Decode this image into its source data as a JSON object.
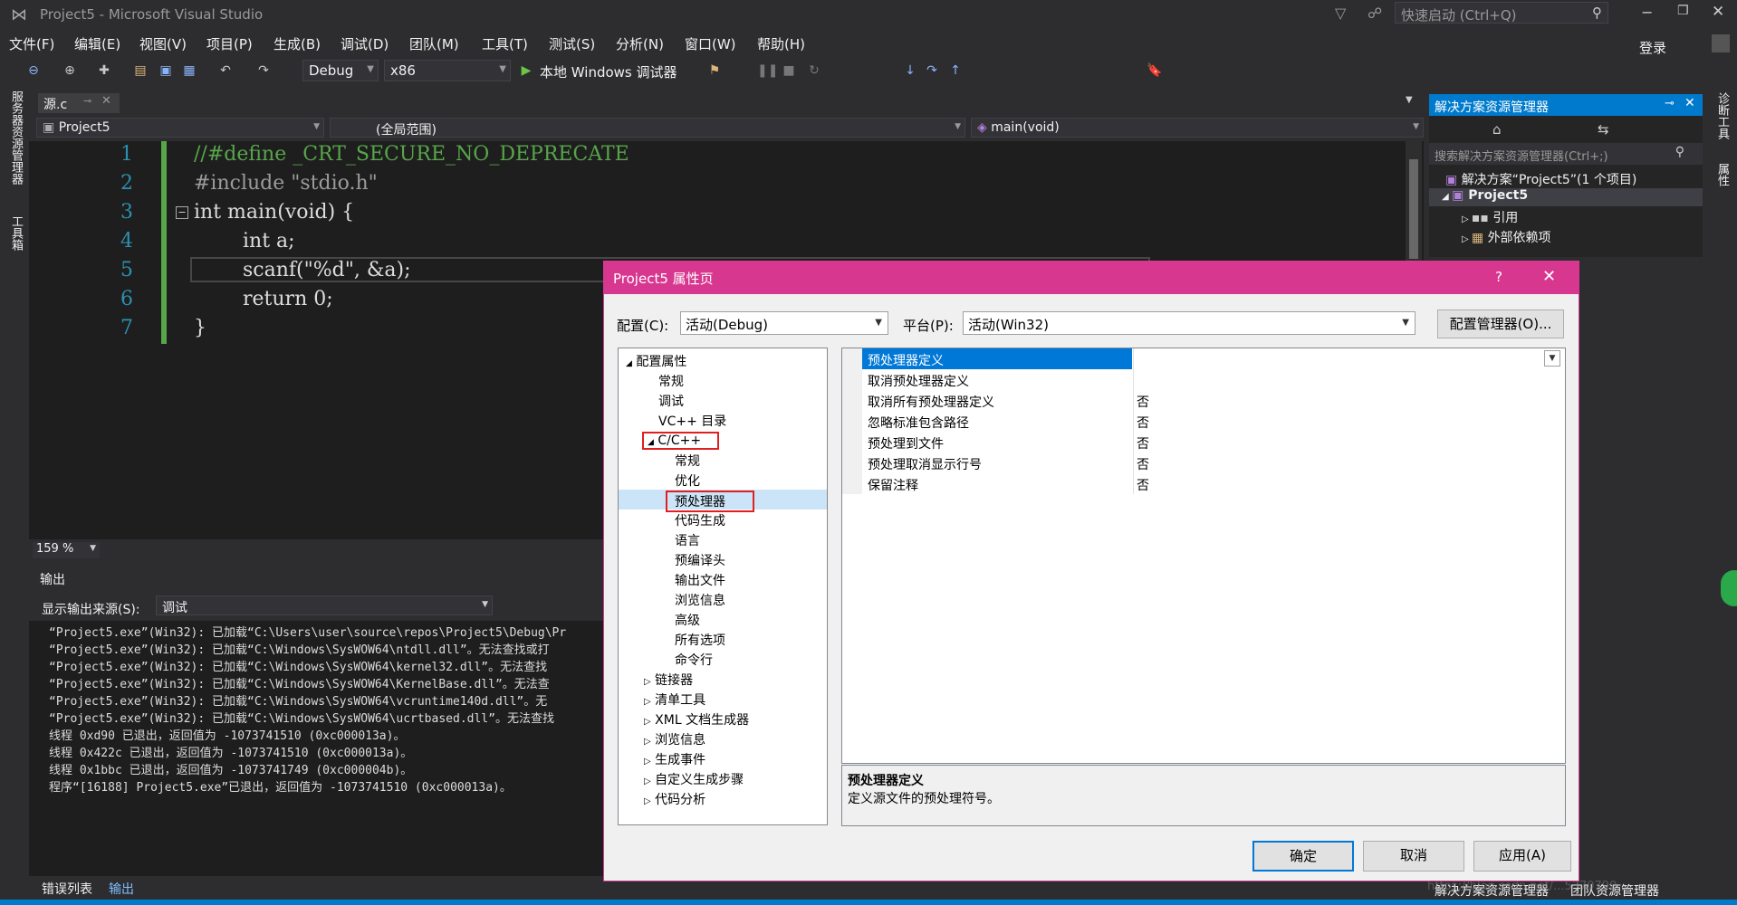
{
  "window": {
    "title": "Project5 - Microsoft Visual Studio",
    "quick_launch": "快速启动 (Ctrl+Q)",
    "login": "登录"
  },
  "menu": [
    "文件(F)",
    "编辑(E)",
    "视图(V)",
    "项目(P)",
    "生成(B)",
    "调试(D)",
    "团队(M)",
    "工具(T)",
    "测试(S)",
    "分析(N)",
    "窗口(W)",
    "帮助(H)"
  ],
  "toolbar": {
    "config": "Debug",
    "platform": "x86",
    "run_label": "本地 Windows 调试器"
  },
  "left_strip": {
    "server_explorer": "服务器资源管理器",
    "toolbox": "工具箱"
  },
  "right_strip": {
    "diagnostics": "诊断工具",
    "properties": "属性"
  },
  "editor": {
    "tab_name": "源.c",
    "nav_project": "Project5",
    "nav_scope": "(全局范围)",
    "nav_function": "main(void)",
    "zoom": "159 %",
    "lines": [
      {
        "num": "1",
        "text": "//#define _CRT_SECURE_NO_DEPRECATE"
      },
      {
        "num": "2",
        "text": "#include \"stdio.h\""
      },
      {
        "num": "3",
        "text": "int main(void) {"
      },
      {
        "num": "4",
        "text": "int a;"
      },
      {
        "num": "5",
        "text": "scanf(\"%d\", &a);"
      },
      {
        "num": "6",
        "text": "return 0;"
      },
      {
        "num": "7",
        "text": "}"
      }
    ]
  },
  "output": {
    "title": "输出",
    "source_label": "显示输出来源(S):",
    "source_value": "调试",
    "lines": [
      "“Project5.exe”(Win32): 已加载“C:\\Users\\user\\source\\repos\\Project5\\Debug\\Pr",
      "“Project5.exe”(Win32): 已加载“C:\\Windows\\SysWOW64\\ntdll.dll”。无法查找或打",
      "“Project5.exe”(Win32): 已加载“C:\\Windows\\SysWOW64\\kernel32.dll”。无法查找",
      "“Project5.exe”(Win32): 已加载“C:\\Windows\\SysWOW64\\KernelBase.dll”。无法查",
      "“Project5.exe”(Win32): 已加载“C:\\Windows\\SysWOW64\\vcruntime140d.dll”。无",
      "“Project5.exe”(Win32): 已加载“C:\\Windows\\SysWOW64\\ucrtbased.dll”。无法查找",
      "线程 0xd90 已退出，返回值为 -1073741510 (0xc000013a)。",
      "线程 0x422c 已退出，返回值为 -1073741510 (0xc000013a)。",
      "线程 0x1bbc 已退出，返回值为 -1073741749 (0xc000004b)。",
      "程序“[16188] Project5.exe”已退出，返回值为 -1073741510 (0xc000013a)。"
    ],
    "tab_errors": "错误列表",
    "tab_output": "输出"
  },
  "solution_explorer": {
    "title": "解决方案资源管理器",
    "search_placeholder": "搜索解决方案资源管理器(Ctrl+;)",
    "solution": "解决方案“Project5”(1 个项目)",
    "project": "Project5",
    "references": "引用",
    "external_deps": "外部依赖项"
  },
  "bottom_right": {
    "left": "解决方案资源管理器",
    "right": "团队资源管理器",
    "watermark": "https://blog.csdn.net/...5370790"
  },
  "dialog": {
    "title": "Project5 属性页",
    "help": "?",
    "config_label": "配置(C):",
    "config_value": "活动(Debug)",
    "platform_label": "平台(P):",
    "platform_value": "活动(Win32)",
    "config_manager": "配置管理器(O)...",
    "tree": [
      {
        "label": "配置属性",
        "level": 0,
        "expander": "◢"
      },
      {
        "label": "常规",
        "level": 1,
        "expander": ""
      },
      {
        "label": "调试",
        "level": 1,
        "expander": ""
      },
      {
        "label": "VC++ 目录",
        "level": 1,
        "expander": ""
      },
      {
        "label": "C/C++",
        "level": 1,
        "expander": "◢"
      },
      {
        "label": "常规",
        "level": 2,
        "expander": ""
      },
      {
        "label": "优化",
        "level": 2,
        "expander": ""
      },
      {
        "label": "预处理器",
        "level": 2,
        "expander": ""
      },
      {
        "label": "代码生成",
        "level": 2,
        "expander": ""
      },
      {
        "label": "语言",
        "level": 2,
        "expander": ""
      },
      {
        "label": "预编译头",
        "level": 2,
        "expander": ""
      },
      {
        "label": "输出文件",
        "level": 2,
        "expander": ""
      },
      {
        "label": "浏览信息",
        "level": 2,
        "expander": ""
      },
      {
        "label": "高级",
        "level": 2,
        "expander": ""
      },
      {
        "label": "所有选项",
        "level": 2,
        "expander": ""
      },
      {
        "label": "命令行",
        "level": 2,
        "expander": ""
      },
      {
        "label": "链接器",
        "level": 1,
        "expander": "▷"
      },
      {
        "label": "清单工具",
        "level": 1,
        "expander": "▷"
      },
      {
        "label": "XML 文档生成器",
        "level": 1,
        "expander": "▷"
      },
      {
        "label": "浏览信息",
        "level": 1,
        "expander": "▷"
      },
      {
        "label": "生成事件",
        "level": 1,
        "expander": "▷"
      },
      {
        "label": "自定义生成步骤",
        "level": 1,
        "expander": "▷"
      },
      {
        "label": "代码分析",
        "level": 1,
        "expander": "▷"
      }
    ],
    "properties": [
      {
        "name": "预处理器定义",
        "value": ""
      },
      {
        "name": "取消预处理器定义",
        "value": ""
      },
      {
        "name": "取消所有预处理器定义",
        "value": "否"
      },
      {
        "name": "忽略标准包含路径",
        "value": "否"
      },
      {
        "name": "预处理到文件",
        "value": "否"
      },
      {
        "name": "预处理取消显示行号",
        "value": "否"
      },
      {
        "name": "保留注释",
        "value": "否"
      }
    ],
    "desc_title": "预处理器定义",
    "desc_text": "定义源文件的预处理符号。",
    "ok": "确定",
    "cancel": "取消",
    "apply": "应用(A)"
  },
  "colors": {
    "accent": "#007acc",
    "dialog_title": "#d8378f",
    "highlight": "#0078d7",
    "red_box": "#e02020"
  }
}
